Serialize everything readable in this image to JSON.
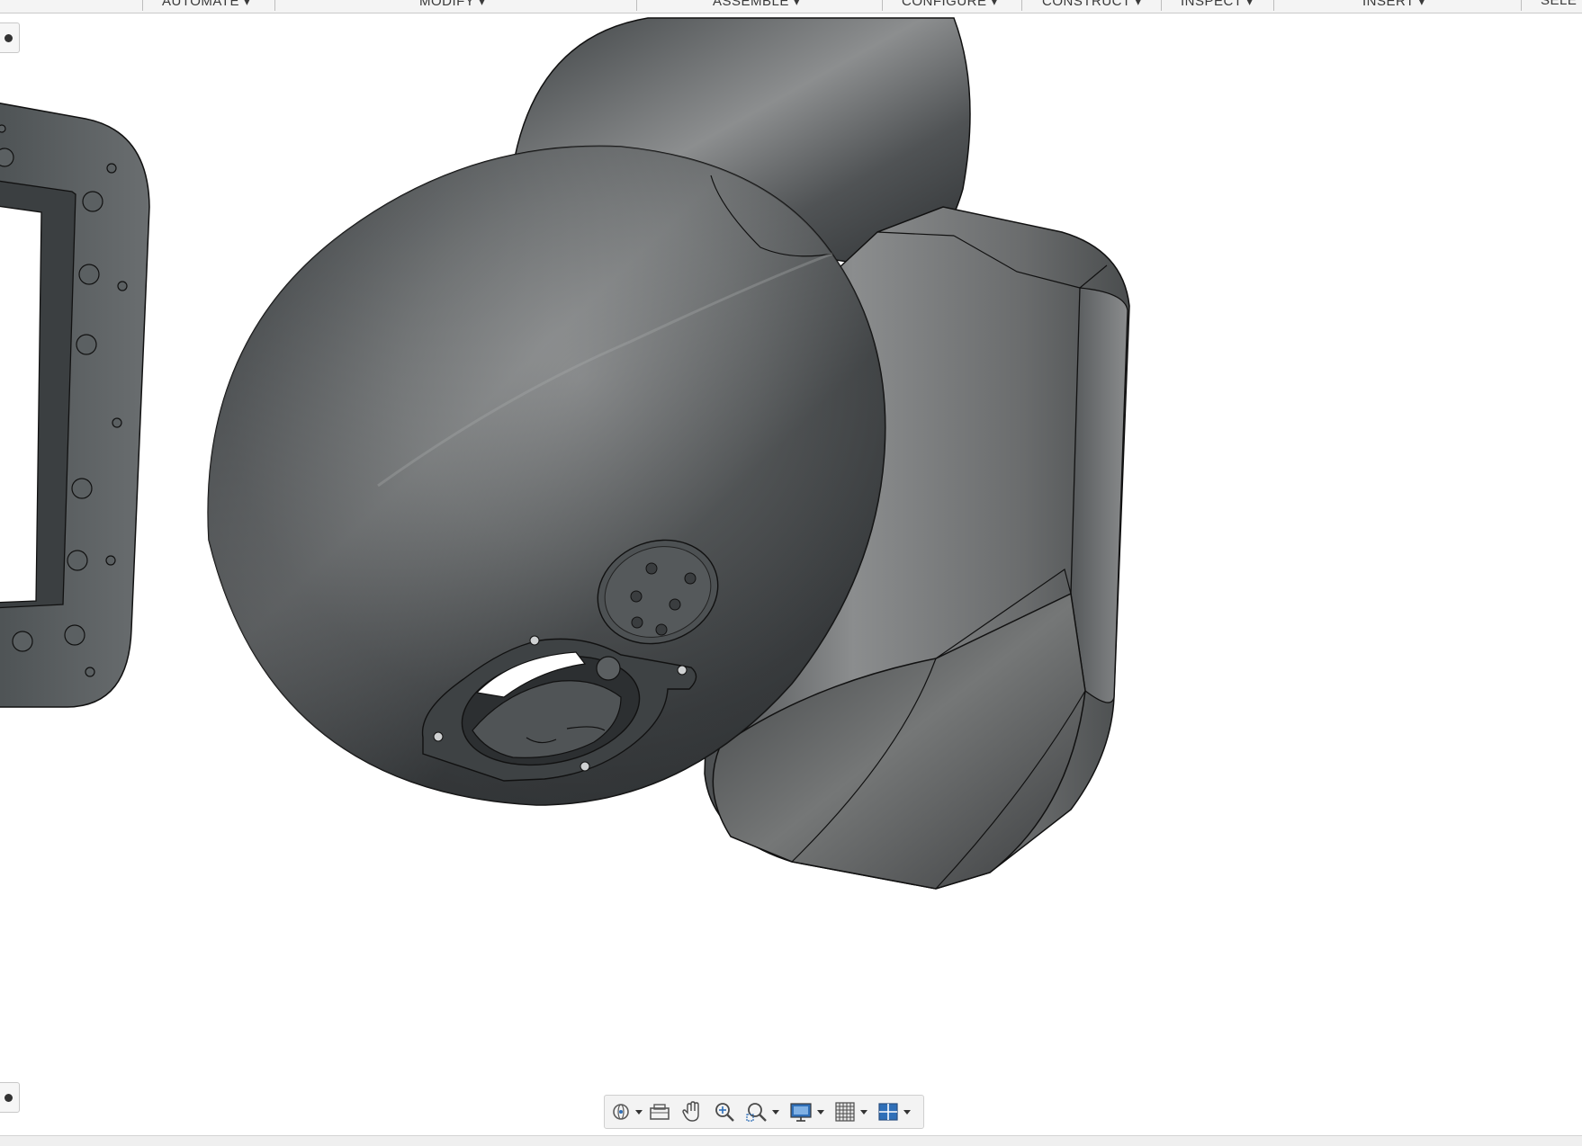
{
  "ribbon": {
    "tabs": [
      {
        "label": "AUTOMATE ▾"
      },
      {
        "label": "MODIFY ▾"
      },
      {
        "label": "ASSEMBLE ▾"
      },
      {
        "label": "CONFIGURE ▾"
      },
      {
        "label": "CONSTRUCT ▾"
      },
      {
        "label": "INSPECT ▾"
      },
      {
        "label": "INSERT ▾"
      },
      {
        "label": "SELE"
      }
    ]
  },
  "navbar": {
    "tools": [
      {
        "icon": "orbit-icon",
        "has_menu": true
      },
      {
        "icon": "look-at-icon",
        "has_menu": false
      },
      {
        "icon": "pan-hand-icon",
        "has_menu": false
      },
      {
        "icon": "zoom-icon",
        "has_menu": false
      },
      {
        "icon": "fit-window-icon",
        "has_menu": true
      },
      {
        "icon": "display-settings-icon",
        "has_menu": true
      },
      {
        "icon": "grid-icon",
        "has_menu": true
      },
      {
        "icon": "viewports-icon",
        "has_menu": true
      }
    ]
  },
  "colors": {
    "body_dark": "#3b3e40",
    "body_mid": "#6e7071",
    "body_light": "#9a9c9d",
    "edge": "#111111",
    "accent_blue": "#2f6fb8"
  }
}
